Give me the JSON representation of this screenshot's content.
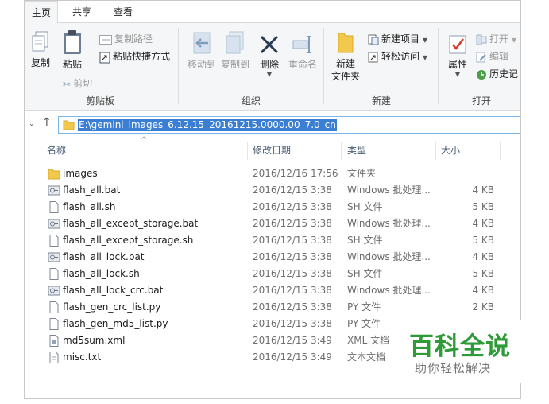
{
  "tabs": [
    {
      "label": "主页",
      "active": true
    },
    {
      "label": "共享",
      "active": false
    },
    {
      "label": "查看",
      "active": false
    }
  ],
  "ribbon": {
    "clipboard": {
      "copy": "复制",
      "paste": "粘贴",
      "copy_path": "复制路径",
      "paste_shortcut": "粘贴快捷方式",
      "cut": "剪切",
      "group_label": "剪贴板"
    },
    "organize": {
      "move_to": "移动到",
      "copy_to": "复制到",
      "delete": "删除",
      "rename": "重命名",
      "group_label": "组织"
    },
    "new": {
      "new_folder": "新建\n文件夹",
      "new_item": "新建项目",
      "easy_access": "轻松访问",
      "group_label": "新建"
    },
    "open": {
      "properties": "属性",
      "open": "打开",
      "edit": "编辑",
      "history": "历史记",
      "group_label": "打开"
    }
  },
  "address": {
    "path": "E:\\gemini_images_6.12.15_20161215.0000.00_7.0_cn"
  },
  "columns": {
    "name": "名称",
    "date": "修改日期",
    "type": "类型",
    "size": "大小"
  },
  "files": [
    {
      "name": "images",
      "date": "2016/12/16 17:56",
      "type": "文件夹",
      "size": "",
      "icon": "folder-icon"
    },
    {
      "name": "flash_all.bat",
      "date": "2016/12/15 3:38",
      "type": "Windows 批处理...",
      "size": "4 KB",
      "icon": "batch-file-icon"
    },
    {
      "name": "flash_all.sh",
      "date": "2016/12/15 3:38",
      "type": "SH 文件",
      "size": "5 KB",
      "icon": "file-icon"
    },
    {
      "name": "flash_all_except_storage.bat",
      "date": "2016/12/15 3:38",
      "type": "Windows 批处理...",
      "size": "4 KB",
      "icon": "batch-file-icon"
    },
    {
      "name": "flash_all_except_storage.sh",
      "date": "2016/12/15 3:38",
      "type": "SH 文件",
      "size": "5 KB",
      "icon": "file-icon"
    },
    {
      "name": "flash_all_lock.bat",
      "date": "2016/12/15 3:38",
      "type": "Windows 批处理...",
      "size": "4 KB",
      "icon": "batch-file-icon"
    },
    {
      "name": "flash_all_lock.sh",
      "date": "2016/12/15 3:38",
      "type": "SH 文件",
      "size": "5 KB",
      "icon": "file-icon"
    },
    {
      "name": "flash_all_lock_crc.bat",
      "date": "2016/12/15 3:38",
      "type": "Windows 批处理...",
      "size": "4 KB",
      "icon": "batch-file-icon"
    },
    {
      "name": "flash_gen_crc_list.py",
      "date": "2016/12/15 3:38",
      "type": "PY 文件",
      "size": "2 KB",
      "icon": "file-icon"
    },
    {
      "name": "flash_gen_md5_list.py",
      "date": "2016/12/15 3:38",
      "type": "PY 文件",
      "size": "",
      "icon": "file-icon"
    },
    {
      "name": "md5sum.xml",
      "date": "2016/12/15 3:49",
      "type": "XML 文档",
      "size": "",
      "icon": "xml-file-icon"
    },
    {
      "name": "misc.txt",
      "date": "2016/12/15 3:49",
      "type": "文本文档",
      "size": "",
      "icon": "text-file-icon"
    }
  ],
  "watermark": {
    "title": "百科全说",
    "subtitle": "助你轻松解决"
  },
  "colors": {
    "ribbon_bg": "#f5f6f7",
    "selection": "#3b7fd4",
    "folder": "#f2c94c",
    "header_text": "#4c607a",
    "watermark_green": "#2f9a38"
  }
}
